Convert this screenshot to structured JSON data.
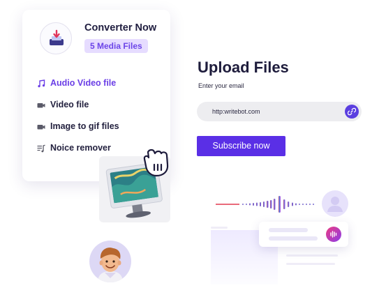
{
  "converter": {
    "title": "Converter Now",
    "badge": "5 Media Files",
    "menu": [
      {
        "label": "Audio Video file",
        "icon": "music-note-icon",
        "active": true
      },
      {
        "label": "Video file",
        "icon": "video-camera-icon",
        "active": false
      },
      {
        "label": "Image to gif files",
        "icon": "video-camera-icon",
        "active": false
      },
      {
        "label": "Noice remover",
        "icon": "playlist-icon",
        "active": false
      }
    ]
  },
  "upload": {
    "title": "Upload Files",
    "email_label": "Enter your email",
    "url_value": "http:writebot.com",
    "subscribe_label": "Subscribe now"
  },
  "colors": {
    "accent": "#5a2fe6",
    "active_menu": "#6b3fe6",
    "badge_bg": "#e6dcff"
  }
}
